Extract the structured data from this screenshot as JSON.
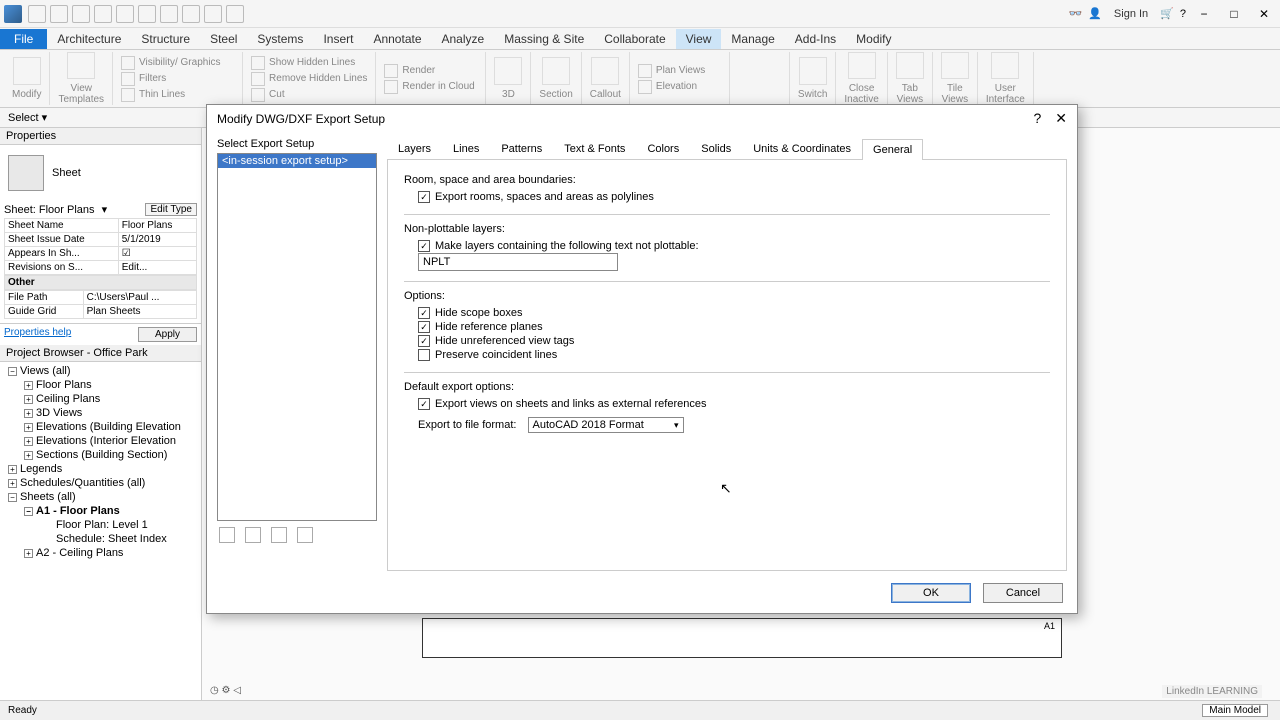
{
  "titlebar": {
    "signin": "Sign In"
  },
  "menubar": {
    "file": "File",
    "items": [
      "Architecture",
      "Structure",
      "Steel",
      "Systems",
      "Insert",
      "Annotate",
      "Analyze",
      "Massing & Site",
      "Collaborate",
      "View",
      "Manage",
      "Add-Ins",
      "Modify"
    ],
    "active": "View"
  },
  "ribbon": {
    "modify": "Modify",
    "view_templates": "View\nTemplates",
    "visibility": "Visibility/ Graphics",
    "filters": "Filters",
    "thin_lines": "Thin  Lines",
    "show_hidden": "Show  Hidden Lines",
    "remove_hidden": "Remove  Hidden Lines",
    "cut": "Cut",
    "render": "Render",
    "render_cloud": "Render  in Cloud",
    "threeD": "3D",
    "section": "Section",
    "callout": "Callout",
    "plan_views": "Plan  Views",
    "elevation": "Elevation",
    "switch": "Switch",
    "close_inactive": "Close\nInactive",
    "tab_views": "Tab\nViews",
    "tile_views": "Tile\nViews",
    "user_interface": "User\nInterface"
  },
  "selectbar": {
    "label": "Select ▾"
  },
  "properties": {
    "title": "Properties",
    "type": "Sheet",
    "combo": "Sheet: Floor Plans",
    "edit_type": "Edit Type",
    "rows": [
      {
        "k": "Sheet Name",
        "v": "Floor Plans"
      },
      {
        "k": "Sheet Issue Date",
        "v": "5/1/2019"
      },
      {
        "k": "Appears In Sh...",
        "v": "☑"
      },
      {
        "k": "Revisions on S...",
        "v": "Edit..."
      }
    ],
    "other": "Other",
    "other_rows": [
      {
        "k": "File Path",
        "v": "C:\\Users\\Paul ..."
      },
      {
        "k": "Guide Grid",
        "v": "Plan Sheets"
      }
    ],
    "help": "Properties help",
    "apply": "Apply"
  },
  "browser": {
    "title": "Project Browser - Office Park",
    "items": [
      {
        "lvl": 1,
        "exp": "−",
        "label": "Views (all)"
      },
      {
        "lvl": 2,
        "exp": "+",
        "label": "Floor Plans"
      },
      {
        "lvl": 2,
        "exp": "+",
        "label": "Ceiling Plans"
      },
      {
        "lvl": 2,
        "exp": "+",
        "label": "3D Views"
      },
      {
        "lvl": 2,
        "exp": "+",
        "label": "Elevations (Building Elevation"
      },
      {
        "lvl": 2,
        "exp": "+",
        "label": "Elevations (Interior Elevation"
      },
      {
        "lvl": 2,
        "exp": "+",
        "label": "Sections (Building Section)"
      },
      {
        "lvl": 1,
        "exp": "+",
        "label": "Legends"
      },
      {
        "lvl": 1,
        "exp": "+",
        "label": "Schedules/Quantities (all)"
      },
      {
        "lvl": 1,
        "exp": "−",
        "label": "Sheets (all)"
      },
      {
        "lvl": 2,
        "exp": "−",
        "label": "A1 - Floor Plans",
        "bold": true
      },
      {
        "lvl": 3,
        "exp": "",
        "label": "Floor Plan: Level 1"
      },
      {
        "lvl": 3,
        "exp": "",
        "label": "Schedule: Sheet Index"
      },
      {
        "lvl": 2,
        "exp": "+",
        "label": "A2 - Ceiling Plans"
      }
    ]
  },
  "dialog": {
    "title": "Modify DWG/DXF Export Setup",
    "setup_label": "Select Export Setup",
    "setup_selected": "<in-session export setup>",
    "tabs": [
      "Layers",
      "Lines",
      "Patterns",
      "Text & Fonts",
      "Colors",
      "Solids",
      "Units & Coordinates",
      "General"
    ],
    "active_tab": "General",
    "section1": "Room, space and area boundaries:",
    "chk1": "Export rooms, spaces and areas as polylines",
    "section2": "Non-plottable layers:",
    "chk2": "Make layers containing the following text not plottable:",
    "input2": "NPLT",
    "section3": "Options:",
    "chk3a": "Hide scope boxes",
    "chk3b": "Hide reference planes",
    "chk3c": "Hide unreferenced view tags",
    "chk3d": "Preserve coincident lines",
    "section4": "Default export options:",
    "chk4": "Export views on sheets and links as external references",
    "format_label": "Export to file format:",
    "format_value": "AutoCAD 2018 Format",
    "ok": "OK",
    "cancel": "Cancel"
  },
  "status": {
    "ready": "Ready",
    "model": "Main Model"
  },
  "sheet_tag": "A1",
  "watermark": "LinkedIn LEARNING"
}
